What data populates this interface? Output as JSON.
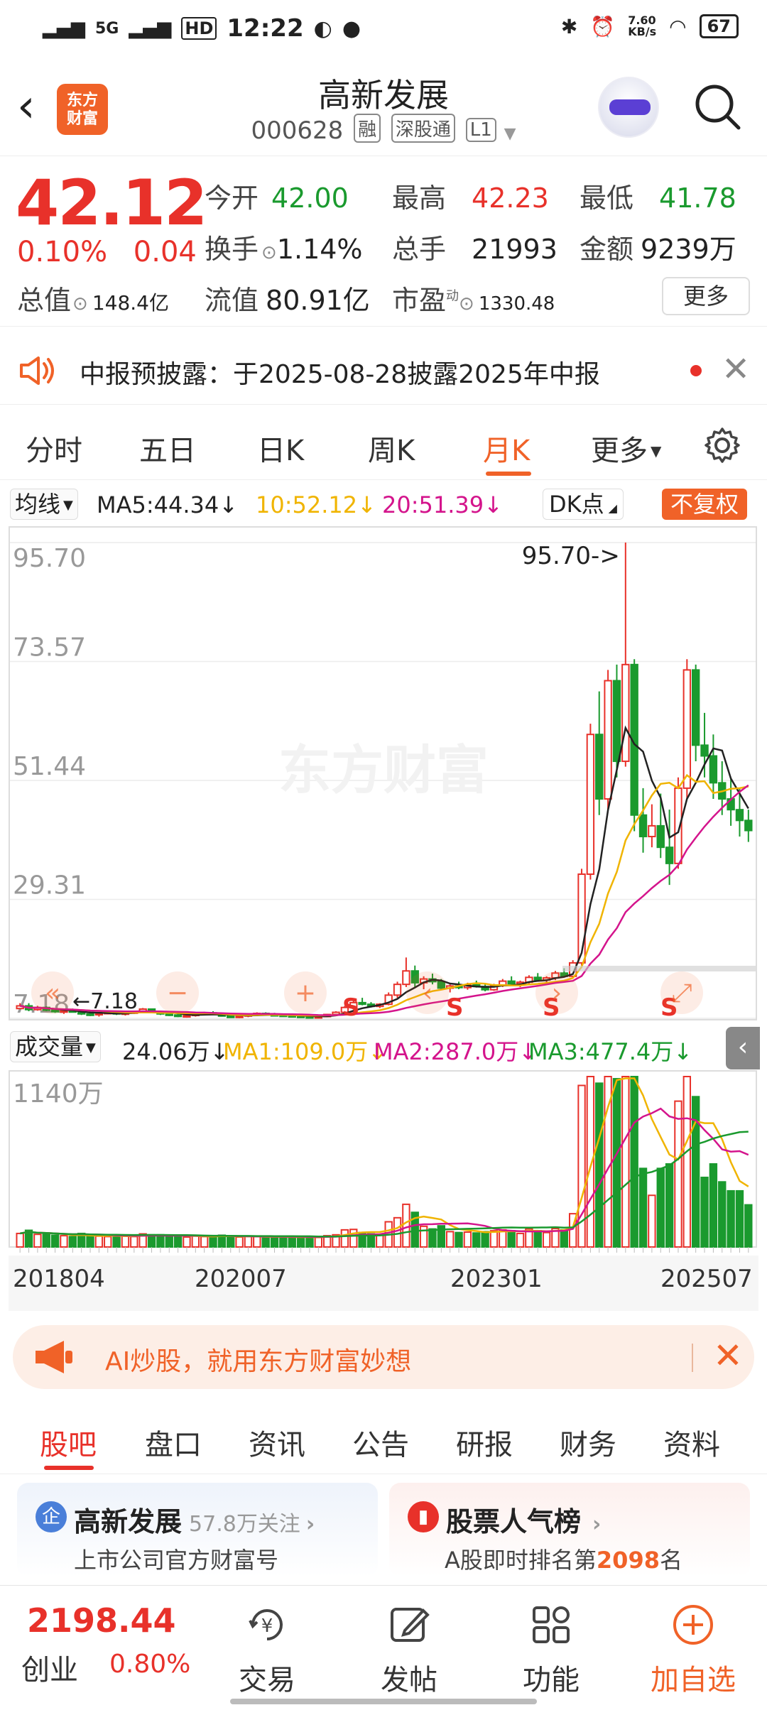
{
  "status_bar": {
    "network1": "5G",
    "network2": "HD",
    "time": "12:22",
    "speed": "7.60\nKB/s",
    "battery": "67"
  },
  "header": {
    "brand_label": "东方财富",
    "title": "高新发展",
    "code": "000628",
    "tags": [
      "融",
      "深股通",
      "L1"
    ]
  },
  "quote": {
    "price": "42.12",
    "change_pct": "0.10%",
    "change_amt": "0.04",
    "fields": [
      {
        "label": "今开",
        "value": "42.00",
        "color": "green"
      },
      {
        "label": "最高",
        "value": "42.23",
        "color": "red"
      },
      {
        "label": "最低",
        "value": "41.78",
        "color": "green"
      },
      {
        "label": "换手",
        "value": "1.14%",
        "color": "black"
      },
      {
        "label": "总手",
        "value": "21993",
        "color": "black"
      },
      {
        "label": "金额",
        "value": "9239万",
        "color": "black"
      },
      {
        "label": "总值",
        "value": "148.4亿",
        "color": "black"
      },
      {
        "label": "流值",
        "value": "80.91亿",
        "color": "black"
      },
      {
        "label": "市盈",
        "value": "1330.48",
        "color": "black"
      }
    ],
    "pe_sup": "动",
    "more_button": "更多"
  },
  "notice": {
    "text": "中报预披露：于2025-08-28披露2025年中报"
  },
  "period_tabs": [
    "分时",
    "五日",
    "日K",
    "周K",
    "月K",
    "更多"
  ],
  "active_period": "月K",
  "ma_row": {
    "selector": "均线",
    "ma5": "MA5:44.34",
    "ma10": "10:52.12",
    "ma20": "20:51.39",
    "dk": "DK点",
    "fuquan": "不复权"
  },
  "vol_row": {
    "selector": "成交量",
    "vol": "24.06万",
    "ma1": "MA1:109.0万",
    "ma2": "MA2:287.0万",
    "ma3": "MA3:477.4万"
  },
  "colors": {
    "up": "#e8312a",
    "down": "#1a9a2e",
    "accent": "#f06228",
    "ma5": "#222222",
    "ma10": "#f0b400",
    "ma20": "#d4148c"
  },
  "chart_data": {
    "type": "candlestick",
    "y_ticks": [
      "95.70",
      "73.57",
      "51.44",
      "29.31",
      "7.18"
    ],
    "ylim": [
      7.18,
      95.7
    ],
    "max_label": "95.70->",
    "min_label": "7.18",
    "vol_max_label": "1140万",
    "x_ticks": [
      "201804",
      "202007",
      "202301",
      "202507"
    ],
    "watermark": "东方财富",
    "signal": "S",
    "candles_approx": [
      [
        9,
        10,
        9,
        9.5
      ],
      [
        9.5,
        10,
        8.5,
        8.8
      ],
      [
        8.8,
        9.5,
        8.6,
        9.2
      ],
      [
        9.2,
        9.4,
        8.5,
        8.7
      ],
      [
        8.7,
        9,
        8.2,
        8.4
      ],
      [
        8.4,
        8.8,
        8,
        8.6
      ],
      [
        8.6,
        9,
        8.3,
        8.5
      ],
      [
        8.5,
        8.8,
        7.8,
        8
      ],
      [
        8,
        8.3,
        7.6,
        7.9
      ],
      [
        7.9,
        8.2,
        7.5,
        8.1
      ],
      [
        8.1,
        8.5,
        7.9,
        8.3
      ],
      [
        8.3,
        8.6,
        7.8,
        8
      ],
      [
        8,
        8.4,
        7.7,
        8.2
      ],
      [
        8.2,
        8.6,
        8,
        8.4
      ],
      [
        8.4,
        9.1,
        8.2,
        8.9
      ],
      [
        8.9,
        9,
        8.3,
        8.4
      ],
      [
        8.4,
        8.6,
        7.8,
        8
      ],
      [
        8,
        8.3,
        7.6,
        7.8
      ],
      [
        7.8,
        8.1,
        7.4,
        7.6
      ],
      [
        7.6,
        7.9,
        7.3,
        7.7
      ],
      [
        7.7,
        8.2,
        7.5,
        8
      ],
      [
        8,
        8.4,
        7.8,
        8.2
      ],
      [
        8.2,
        8.5,
        7.9,
        8
      ],
      [
        8,
        8.2,
        7.5,
        7.6
      ],
      [
        7.6,
        7.9,
        7.3,
        7.5
      ],
      [
        7.5,
        7.8,
        7.2,
        7.6
      ],
      [
        7.6,
        8,
        7.4,
        7.9
      ],
      [
        7.9,
        8.3,
        7.7,
        8.1
      ],
      [
        8.1,
        8.3,
        7.8,
        7.9
      ],
      [
        7.9,
        8.2,
        7.6,
        7.8
      ],
      [
        7.8,
        8.1,
        7.5,
        7.7
      ],
      [
        7.7,
        8,
        7.4,
        7.6
      ],
      [
        7.6,
        7.9,
        7.3,
        7.5
      ],
      [
        7.5,
        7.8,
        7.2,
        7.4
      ],
      [
        7.4,
        7.7,
        7.2,
        7.5
      ],
      [
        7.5,
        8,
        7.4,
        7.9
      ],
      [
        7.9,
        8.5,
        7.7,
        8.3
      ],
      [
        8.3,
        9.5,
        8.1,
        9.2
      ],
      [
        9.2,
        10.5,
        9,
        10.1
      ],
      [
        10.1,
        11,
        9.6,
        9.8
      ],
      [
        9.8,
        10.2,
        9.2,
        9.4
      ],
      [
        9.4,
        10,
        9.1,
        9.8
      ],
      [
        9.8,
        12,
        9.6,
        11.5
      ],
      [
        11.5,
        14,
        11,
        13.5
      ],
      [
        13.5,
        18.5,
        13,
        16
      ],
      [
        16,
        17,
        13,
        13.8
      ],
      [
        13.8,
        15,
        12.6,
        14.5
      ],
      [
        14.5,
        15.5,
        13.5,
        14
      ],
      [
        14,
        14.5,
        12.5,
        12.8
      ],
      [
        12.8,
        13.5,
        12,
        13.2
      ],
      [
        13.2,
        14,
        12.6,
        12.9
      ],
      [
        12.9,
        13.8,
        12.5,
        13.4
      ],
      [
        13.4,
        14.2,
        12.9,
        13.1
      ],
      [
        13.1,
        13.5,
        12.2,
        12.5
      ],
      [
        12.5,
        13.6,
        12.3,
        13.3
      ],
      [
        13.3,
        14.5,
        13,
        14.1
      ],
      [
        14.1,
        15,
        13.4,
        13.6
      ],
      [
        13.6,
        14.2,
        13,
        13.9
      ],
      [
        13.9,
        15.2,
        13.6,
        14.8
      ],
      [
        14.8,
        15.6,
        14,
        14.3
      ],
      [
        14.3,
        15,
        13.7,
        14.7
      ],
      [
        14.7,
        16,
        14.3,
        15.6
      ],
      [
        15.6,
        16.5,
        14.8,
        15
      ],
      [
        15,
        18,
        14.6,
        17.5
      ],
      [
        17.5,
        35,
        17,
        34
      ],
      [
        34,
        62,
        33,
        60
      ],
      [
        60,
        68,
        45,
        48
      ],
      [
        48,
        72,
        46,
        70
      ],
      [
        70,
        73,
        52,
        55
      ],
      [
        55,
        95.7,
        54,
        73
      ],
      [
        73,
        74,
        42,
        45
      ],
      [
        45,
        50,
        38,
        41
      ],
      [
        41,
        47,
        39,
        43
      ],
      [
        43,
        49,
        37,
        39
      ],
      [
        39,
        46,
        32,
        36
      ],
      [
        36,
        52,
        35,
        50
      ],
      [
        50,
        74,
        48,
        72
      ],
      [
        72,
        73,
        55,
        58
      ],
      [
        58,
        64,
        52,
        56
      ],
      [
        56,
        60,
        48,
        51
      ],
      [
        51,
        55,
        45,
        48
      ],
      [
        48,
        52,
        43,
        46
      ],
      [
        46,
        50,
        41,
        44
      ],
      [
        44,
        46,
        40,
        42.12
      ]
    ]
  },
  "ai_banner": {
    "text": "AI炒股，就用东方财富妙想"
  },
  "section_tabs": [
    "股吧",
    "盘口",
    "资讯",
    "公告",
    "研报",
    "财务",
    "资料"
  ],
  "active_section": "股吧",
  "cards": [
    {
      "title": "高新发展",
      "follow": "57.8万关注",
      "subtitle": "上市公司官方财富号",
      "icon": "企"
    },
    {
      "title": "股票人气榜",
      "subtitle_prefix": "A股即时排名第",
      "rank": "2098",
      "subtitle_suffix": "名"
    }
  ],
  "bottom_bar": {
    "index_value": "2198.44",
    "index_name": "创业",
    "index_pct": "0.80%",
    "items": [
      "交易",
      "发帖",
      "功能",
      "加自选"
    ]
  }
}
